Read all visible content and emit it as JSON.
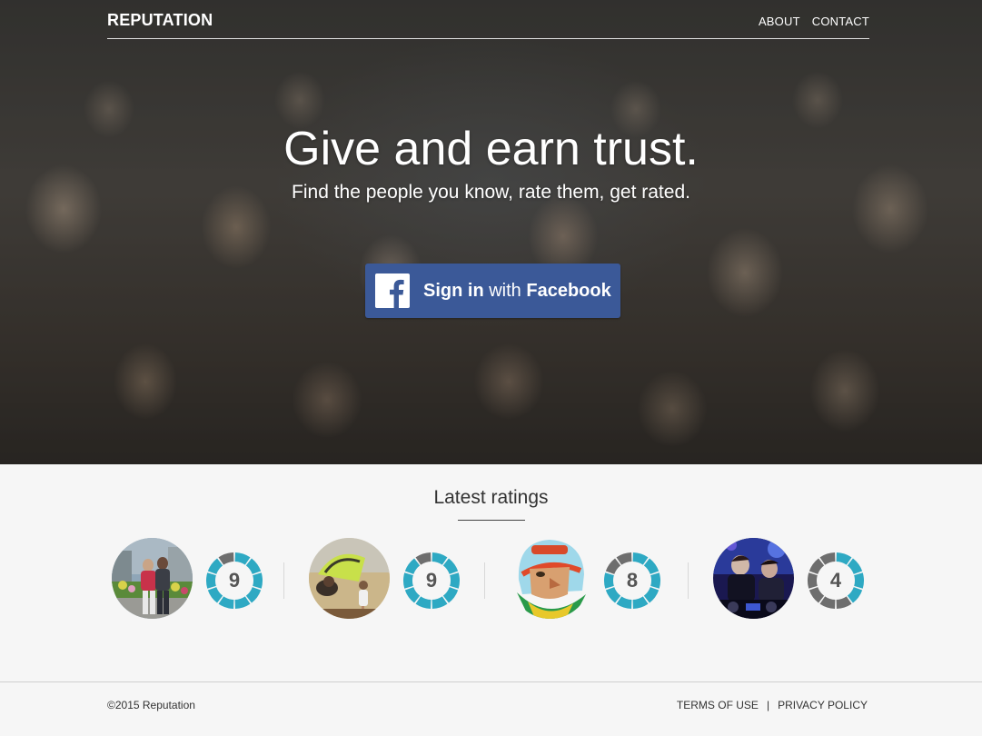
{
  "brand": "REPUTATION",
  "nav": {
    "about": "ABOUT",
    "contact": "CONTACT"
  },
  "hero": {
    "headline": "Give and earn trust.",
    "subline": "Find the people you know, rate them, get rated."
  },
  "facebook_button": {
    "icon": "facebook-icon",
    "sign_in": "Sign in",
    "with": "with",
    "facebook": "Facebook",
    "color": "#3b5998"
  },
  "ratings": {
    "title": "Latest ratings",
    "items": [
      {
        "score": "9",
        "avatar": "couple-photo"
      },
      {
        "score": "9",
        "avatar": "kids-beach-photo"
      },
      {
        "score": "8",
        "avatar": "helmet-illustration"
      },
      {
        "score": "4",
        "avatar": "dj-photo"
      }
    ],
    "gauge_filled_color": "#2ea9c3",
    "gauge_empty_color": "#6e6e6e"
  },
  "footer": {
    "copyright": "©2015 Reputation",
    "terms": "TERMS OF USE",
    "divider": "|",
    "privacy": "PRIVACY POLICY"
  }
}
